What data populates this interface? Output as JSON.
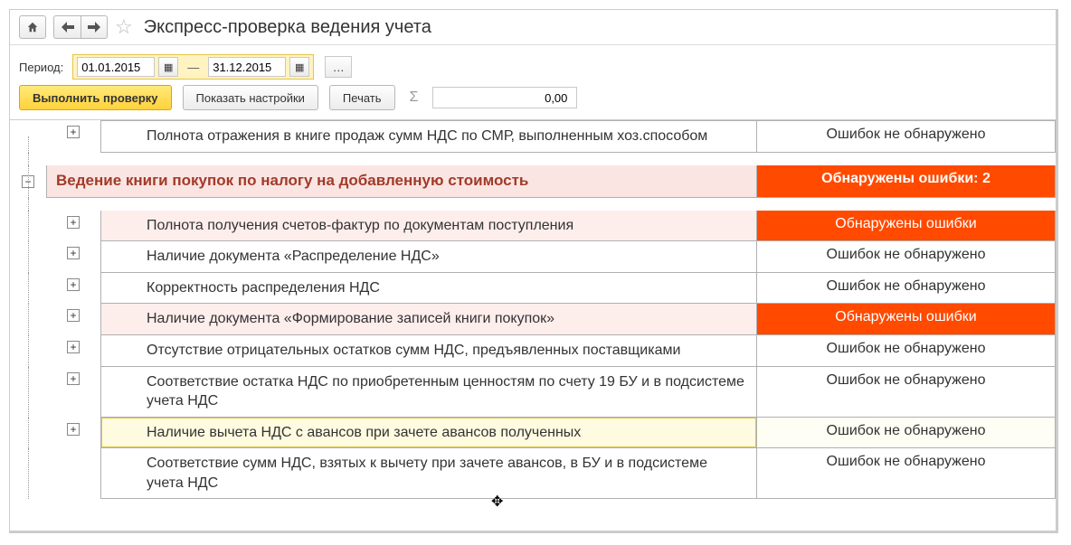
{
  "header": {
    "title": "Экспресс-проверка ведения учета"
  },
  "period": {
    "label": "Период:",
    "from": "01.01.2015",
    "to": "31.12.2015"
  },
  "toolbar": {
    "run_label": "Выполнить проверку",
    "settings_label": "Показать настройки",
    "print_label": "Печать",
    "sum_value": "0,00"
  },
  "status_text": {
    "ok": "Ошибок не обнаружено",
    "errors": "Обнаружены ошибки",
    "errors_count": "Обнаружены ошибки: 2"
  },
  "rows": [
    {
      "kind": "ok",
      "expand": "plus",
      "text": "Полнота отражения в книге продаж сумм НДС по СМР, выполненным хоз.способом",
      "status_key": "ok"
    },
    {
      "kind": "gap"
    },
    {
      "kind": "section",
      "expand": "minus",
      "text": "Ведение книги покупок по налогу на добавленную стоимость",
      "status_key": "errors_count"
    },
    {
      "kind": "gap"
    },
    {
      "kind": "err",
      "expand": "plus",
      "text": "Полнота получения счетов-фактур по документам поступления",
      "status_key": "errors"
    },
    {
      "kind": "ok",
      "expand": "plus",
      "text": "Наличие документа «Распределение НДС»",
      "status_key": "ok"
    },
    {
      "kind": "ok",
      "expand": "plus",
      "text": "Корректность распределения НДС",
      "status_key": "ok"
    },
    {
      "kind": "err",
      "expand": "plus",
      "text": "Наличие документа «Формирование записей книги покупок»",
      "status_key": "errors"
    },
    {
      "kind": "ok",
      "expand": "plus",
      "text": "Отсутствие отрицательных остатков сумм НДС, предъявленных поставщиками",
      "status_key": "ok"
    },
    {
      "kind": "ok",
      "expand": "plus",
      "text": "Соответствие остатка НДС по приобретенным ценностям по счету 19 БУ и в подсистеме учета НДС",
      "status_key": "ok"
    },
    {
      "kind": "ok-sel",
      "expand": "plus",
      "text": "Наличие вычета НДС с авансов при зачете авансов полученных",
      "status_key": "ok"
    },
    {
      "kind": "ok",
      "expand": "none",
      "text": "Соответствие сумм НДС, взятых к вычету при зачете авансов, в БУ и в подсистеме учета НДС",
      "status_key": "ok"
    }
  ]
}
